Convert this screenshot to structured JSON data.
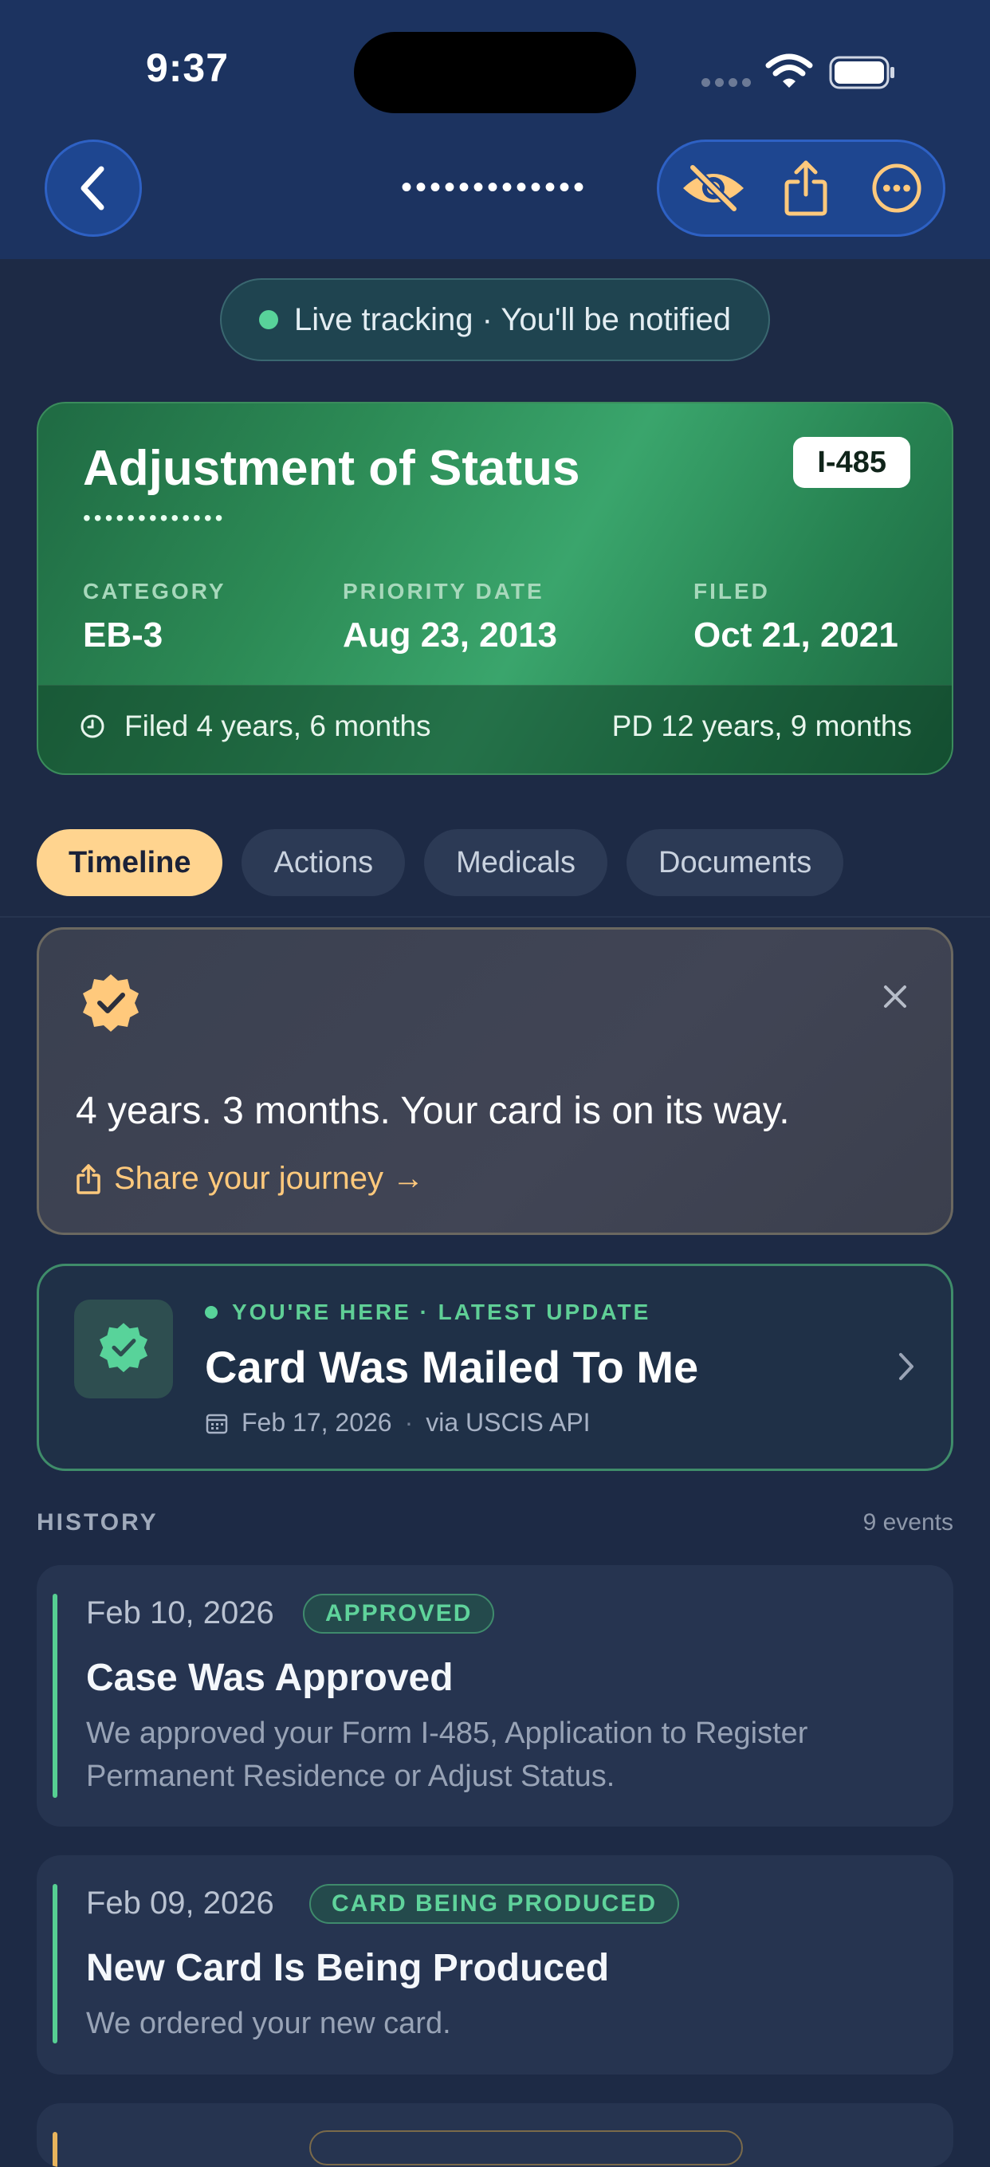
{
  "status_bar": {
    "time": "9:37"
  },
  "nav": {
    "masked_title": "•••••••••••••"
  },
  "live_tracking": {
    "text": "Live tracking · You'll be notified"
  },
  "case": {
    "title": "Adjustment of Status",
    "masked_receipt": "•••••••••••••",
    "form": "I-485",
    "category_label": "CATEGORY",
    "category_value": "EB-3",
    "priority_label": "PRIORITY DATE",
    "priority_value": "Aug 23, 2013",
    "filed_label": "FILED",
    "filed_value": "Oct 21, 2021",
    "filed_duration": "Filed 4 years, 6 months",
    "pd_duration": "PD 12 years, 9 months"
  },
  "tabs": [
    {
      "label": "Timeline",
      "active": true
    },
    {
      "label": "Actions",
      "active": false
    },
    {
      "label": "Medicals",
      "active": false
    },
    {
      "label": "Documents",
      "active": false
    }
  ],
  "celebration": {
    "message": "4 years. 3 months. Your card is on its way.",
    "share_label": "Share your journey →"
  },
  "latest": {
    "eyebrow": "YOU'RE HERE · LATEST UPDATE",
    "title": "Card Was Mailed To Me",
    "date": "Feb 17, 2026",
    "separator": "·",
    "source": "via USCIS API"
  },
  "history": {
    "label": "HISTORY",
    "count": "9 events",
    "events": [
      {
        "date": "Feb 10, 2026",
        "tag": "APPROVED",
        "title": "Case Was Approved",
        "description": "We approved your Form I-485, Application to Register Permanent Residence or Adjust Status."
      },
      {
        "date": "Feb 09, 2026",
        "tag": "CARD BEING PRODUCED",
        "title": "New Card Is Being Produced",
        "description": "We ordered your new card."
      }
    ]
  },
  "colors": {
    "accent_green": "#58d39a",
    "accent_amber": "#ffd48f",
    "header_blue": "#1c3360",
    "background": "#1d2a45"
  },
  "icons": [
    "chevron-left-icon",
    "eye-slash-icon",
    "share-icon",
    "more-icon",
    "clock-icon",
    "verified-badge-icon",
    "close-icon",
    "calendar-icon",
    "chevron-right-icon"
  ]
}
